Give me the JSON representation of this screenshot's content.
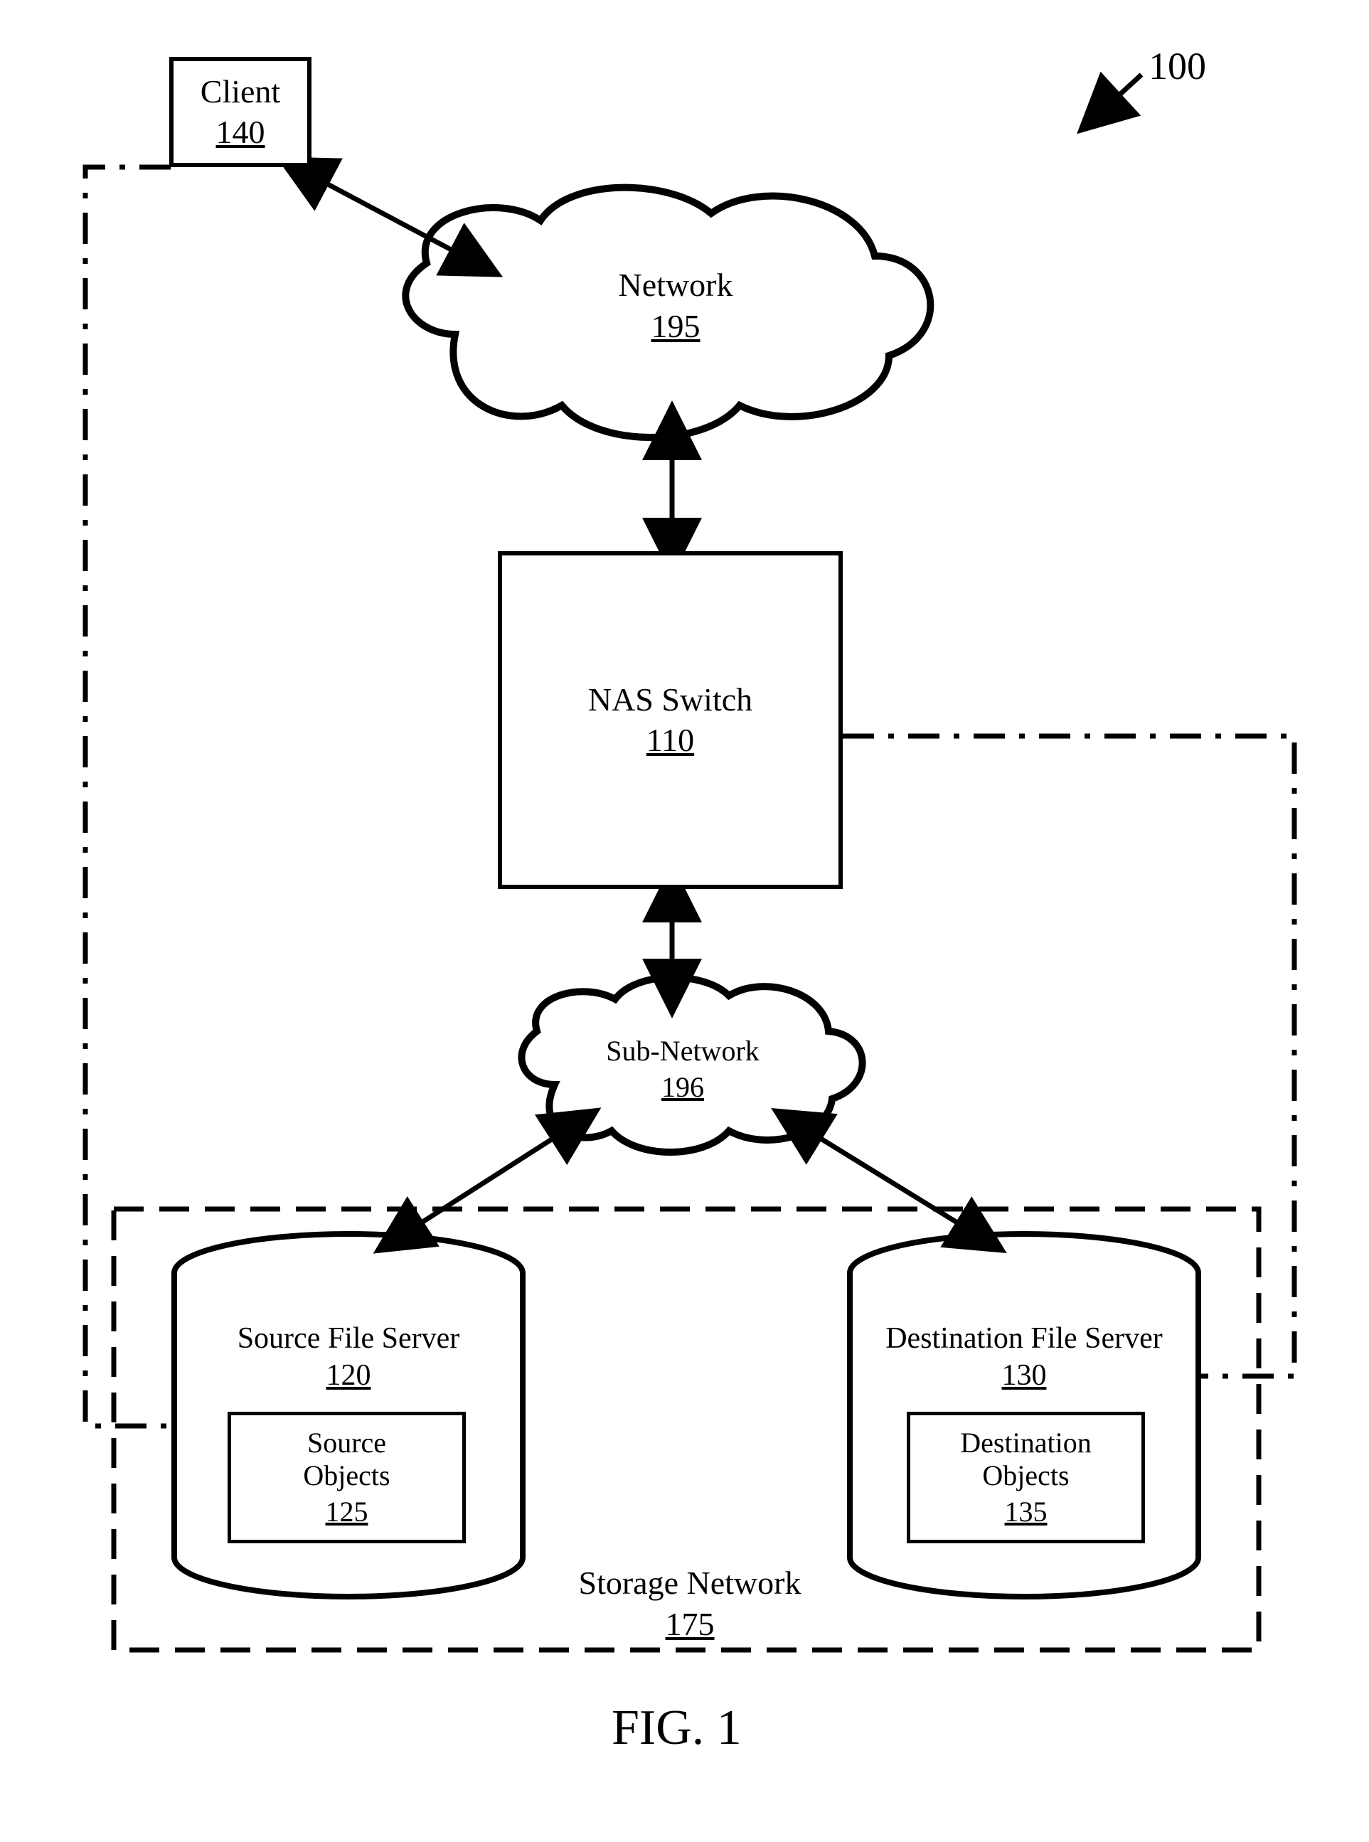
{
  "figure": {
    "ref": "100",
    "caption": "FIG. 1"
  },
  "nodes": {
    "client": {
      "title": "Client",
      "num": "140"
    },
    "network": {
      "title": "Network",
      "num": "195"
    },
    "nas": {
      "title": "NAS Switch",
      "num": "110"
    },
    "subnet": {
      "title": "Sub-Network",
      "num": "196"
    },
    "srcServer": {
      "title": "Source File Server",
      "num": "120"
    },
    "srcObjects": {
      "title": "Source\nObjects",
      "num": "125"
    },
    "dstServer": {
      "title": "Destination File Server",
      "num": "130"
    },
    "dstObjects": {
      "title": "Destination\nObjects",
      "num": "135"
    },
    "storage": {
      "title": "Storage Network",
      "num": "175"
    }
  }
}
